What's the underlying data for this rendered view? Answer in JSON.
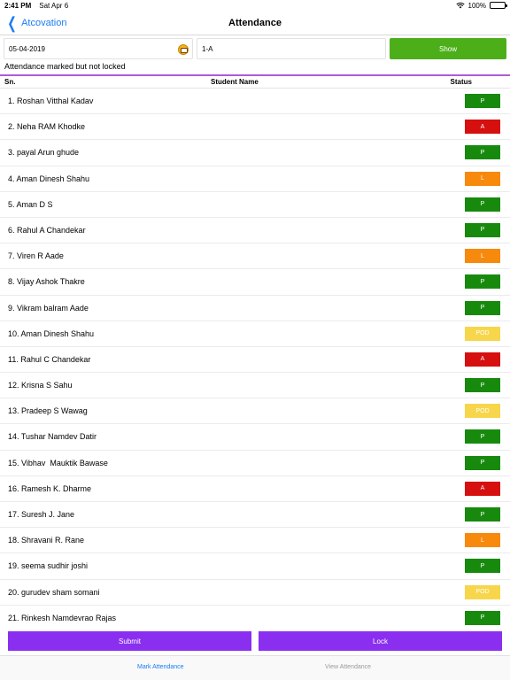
{
  "status_bar": {
    "time": "2:41 PM",
    "date": "Sat Apr 6",
    "battery": "100%"
  },
  "nav": {
    "back_label": "Atcovation",
    "title": "Attendance"
  },
  "controls": {
    "date_value": "05-04-2019",
    "class_value": "1-A",
    "show_label": "Show"
  },
  "notice": "Attendance marked but not locked",
  "table": {
    "headers": {
      "sn": "Sn.",
      "name": "Student Name",
      "status": "Status"
    },
    "rows": [
      {
        "label": "1. Roshan Vitthal Kadav",
        "status": "P"
      },
      {
        "label": "2. Neha RAM Khodke",
        "status": "A"
      },
      {
        "label": "3. payal Arun ghude",
        "status": "P"
      },
      {
        "label": "4. Aman Dinesh Shahu",
        "status": "L"
      },
      {
        "label": "5. Aman D S",
        "status": "P"
      },
      {
        "label": "6. Rahul A Chandekar",
        "status": "P"
      },
      {
        "label": "7. Viren R Aade",
        "status": "L"
      },
      {
        "label": "8. Vijay Ashok Thakre",
        "status": "P"
      },
      {
        "label": "9. Vikram balram Aade",
        "status": "P"
      },
      {
        "label": "10. Aman Dinesh Shahu",
        "status": "POD"
      },
      {
        "label": "11. Rahul C Chandekar",
        "status": "A"
      },
      {
        "label": "12. Krisna S Sahu",
        "status": "P"
      },
      {
        "label": "13. Pradeep S Wawag",
        "status": "POD"
      },
      {
        "label": "14. Tushar Namdev Datir",
        "status": "P"
      },
      {
        "label": "15. Vibhav  Mauktik Bawase",
        "status": "P"
      },
      {
        "label": "16. Ramesh K. Dharme",
        "status": "A"
      },
      {
        "label": "17. Suresh J. Jane",
        "status": "P"
      },
      {
        "label": "18. Shravani R. Rane",
        "status": "L"
      },
      {
        "label": "19. seema sudhir joshi",
        "status": "P"
      },
      {
        "label": "20. gurudev sham somani",
        "status": "POD"
      },
      {
        "label": "21. Rinkesh Namdevrao Rajas",
        "status": "P"
      }
    ]
  },
  "actions": {
    "submit_label": "Submit",
    "lock_label": "Lock"
  },
  "tabs": [
    {
      "label": "Mark Attendance",
      "active": true
    },
    {
      "label": "View Attendance",
      "active": false
    }
  ],
  "colors": {
    "accent": "#1a7cf5",
    "show": "#4caf1a",
    "present": "#178a0e",
    "absent": "#d60f0f",
    "leave": "#f7890c",
    "pod": "#f7d64b",
    "action": "#8a2ff0",
    "divider": "#b05ad6"
  }
}
